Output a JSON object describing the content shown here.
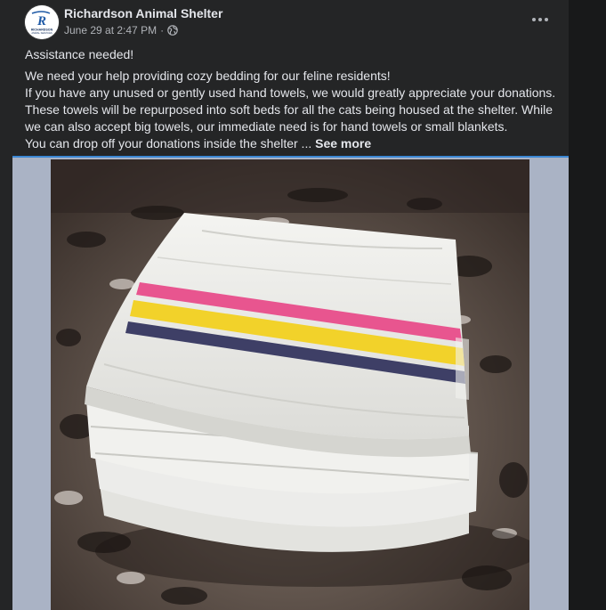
{
  "post": {
    "page_name": "Richardson Animal Shelter",
    "timestamp": "June 29 at 2:47 PM",
    "separator": "·",
    "audience_icon": "globe-icon",
    "menu_icon": "more-options-icon",
    "avatar": {
      "logo_letter": "R",
      "logo_text_top": "RICHARDSON",
      "logo_text_bottom": "ANIMAL SERVICES",
      "brand_color": "#1f5aa6"
    },
    "text_lines": [
      "Assistance needed!",
      "We need your help providing cozy bedding for our feline residents!",
      "If you have any unused or gently used hand towels, we would greatly appreciate your donations.",
      "These towels will be repurposed into soft beds for all the cats being housed at the shelter. While",
      "we can also accept big towels, our immediate need is for hand towels or small blankets.",
      "You can drop off your donations inside the shelter ..."
    ],
    "see_more_label": "See more"
  },
  "photo": {
    "subject": "stack of white hand towels with pink, yellow and navy stripes on a granite countertop",
    "stripe_colors": [
      "#e8558f",
      "#f2d22a",
      "#3e3f66"
    ]
  },
  "colors": {
    "background": "#18191a",
    "card": "#242526",
    "text_primary": "#e4e6eb",
    "text_secondary": "#b0b3b8",
    "media_frame": "#aab3c5",
    "accent_line": "#3b87d4"
  }
}
